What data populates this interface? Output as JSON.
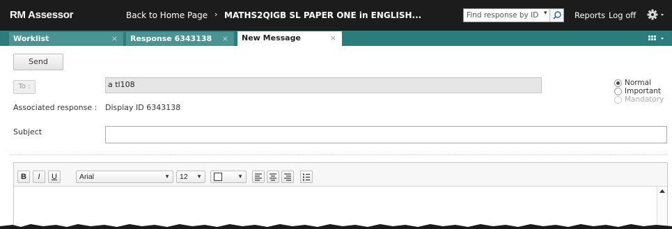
{
  "header": {
    "app_name": "RM Assessor",
    "home_link": "Back to Home Page",
    "breadcrumb_separator": "›",
    "paper_title": "MATHS2QIGB SL PAPER ONE in ENGLISH...",
    "search_placeholder": "Find response by ID",
    "search_icon": "magnifier-icon",
    "reports": "Reports",
    "log_off": "Log off",
    "settings_icon": "gear-icon"
  },
  "tabs": [
    {
      "label": "Worklist",
      "close": "×",
      "active": false
    },
    {
      "label": "Response 6343138",
      "close": "×",
      "active": false
    },
    {
      "label": "New Message",
      "close": "×",
      "active": true
    }
  ],
  "tabbar_menu_icon": "grid-icon",
  "form": {
    "send_label": "Send",
    "to_label": "To :",
    "to_value": "a tl108",
    "associated_label": "Associated response :",
    "associated_value": "Display ID  6343138",
    "subject_label": "Subject",
    "subject_value": ""
  },
  "priority": {
    "options": [
      {
        "label": "Normal",
        "checked": true,
        "disabled": false
      },
      {
        "label": "Important",
        "checked": false,
        "disabled": false
      },
      {
        "label": "Mandatory",
        "checked": false,
        "disabled": true
      }
    ]
  },
  "editor": {
    "bold": "B",
    "italic": "I",
    "underline": "U",
    "font_family": "Arial",
    "font_size": "12",
    "border_icon": "border-box-icon",
    "align_left_icon": "align-left-icon",
    "align_center_icon": "align-center-icon",
    "align_right_icon": "align-right-icon",
    "list_icon": "bullet-list-icon"
  },
  "colors": {
    "header_bg": "#1c1c1c",
    "tabbar_bg": "#2b7d7c",
    "tab_bg": "#4a9594"
  }
}
